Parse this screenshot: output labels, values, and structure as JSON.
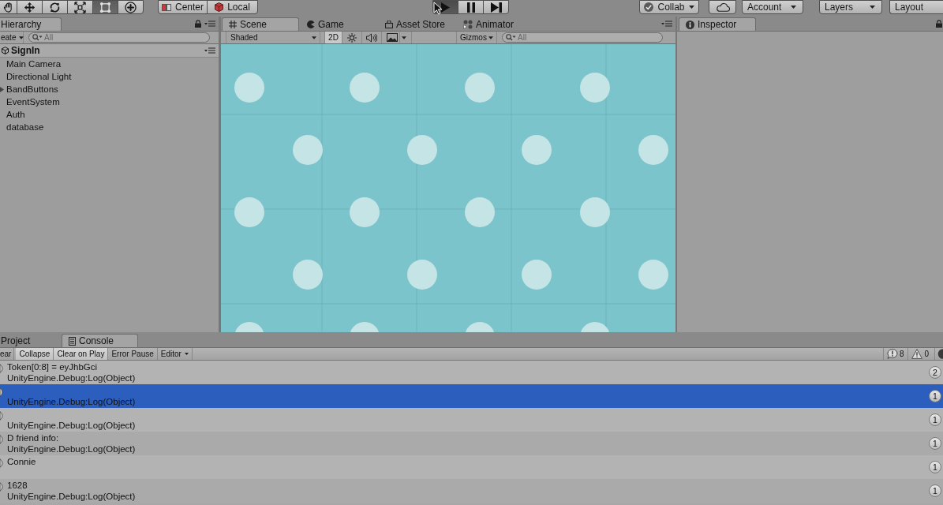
{
  "toolbar": {
    "tools": [
      {
        "kind": "hand",
        "selected": false
      },
      {
        "kind": "move",
        "selected": false
      },
      {
        "kind": "rotate",
        "selected": false
      },
      {
        "kind": "scale",
        "selected": false
      },
      {
        "kind": "rect",
        "selected": true
      },
      {
        "kind": "transform",
        "selected": false
      }
    ],
    "pivot": [
      {
        "kind": "pivot",
        "label": "Center"
      },
      {
        "kind": "space",
        "label": "Local"
      }
    ],
    "playback": [
      {
        "kind": "play",
        "selected": true
      },
      {
        "kind": "pause",
        "selected": false
      },
      {
        "kind": "step",
        "selected": false
      }
    ],
    "services": [
      {
        "kind": "collab",
        "label": "Collab"
      },
      {
        "kind": "cloud"
      },
      {
        "kind": "dropdown",
        "label": "Account"
      },
      {
        "kind": "dropdown",
        "label": "Layers"
      },
      {
        "kind": "plain",
        "label": "Layout"
      }
    ]
  },
  "hierarchy": {
    "tab": {
      "label": "Hierarchy",
      "selected": true
    },
    "create": {
      "label": "eate"
    },
    "search": {
      "placeholder": "All"
    },
    "scene": {
      "name": "SignIn"
    },
    "items": [
      {
        "name": "Main Camera",
        "kind": "object"
      },
      {
        "name": "Directional Light",
        "kind": "object"
      },
      {
        "name": "BandButtons",
        "kind": "parent",
        "expanded": false
      },
      {
        "name": "EventSystem",
        "kind": "object"
      },
      {
        "name": "Auth",
        "kind": "object"
      },
      {
        "name": "database",
        "kind": "object"
      }
    ]
  },
  "scene_panel": {
    "tabs": [
      {
        "kind": "scene",
        "label": "Scene",
        "selected": true
      },
      {
        "kind": "game",
        "label": "Game",
        "selected": false
      },
      {
        "kind": "store",
        "label": "Asset Store",
        "selected": false
      },
      {
        "kind": "animator",
        "label": "Animator",
        "selected": false
      }
    ],
    "toolbar": {
      "shading": {
        "label": "Shaded"
      },
      "toggles": [
        {
          "kind": "mode",
          "label": "2D",
          "on": true
        },
        {
          "kind": "lighting",
          "on": false
        },
        {
          "kind": "audio",
          "on": false
        },
        {
          "kind": "effects",
          "on": false
        }
      ],
      "gizmos": {
        "label": "Gizmos"
      },
      "search": {
        "placeholder": "All"
      }
    }
  },
  "inspector": {
    "tab": {
      "label": "Inspector",
      "selected": true
    }
  },
  "console_panel": {
    "tabs": [
      {
        "kind": "project",
        "label": "Project",
        "selected": false
      },
      {
        "kind": "console",
        "label": "Console",
        "selected": true
      }
    ],
    "toolbar": [
      {
        "kind": "button",
        "label": "ear"
      },
      {
        "kind": "toggle",
        "label": "Collapse",
        "on": true
      },
      {
        "kind": "toggle",
        "label": "Clear on Play",
        "on": true
      },
      {
        "kind": "toggle",
        "label": "Error Pause",
        "on": false
      },
      {
        "kind": "dropdown",
        "label": "Editor"
      }
    ],
    "counters": [
      {
        "kind": "info",
        "count": "8"
      },
      {
        "kind": "warning",
        "count": "0"
      },
      {
        "kind": "error"
      }
    ],
    "entries": [
      {
        "message": "Token[0:8] = eyJhbGci",
        "trace": "UnityEngine.Debug:Log(Object)",
        "count": "2",
        "selected": false
      },
      {
        "trace": "UnityEngine.Debug:Log(Object)",
        "count": "1",
        "selected": true
      },
      {
        "trace": "UnityEngine.Debug:Log(Object)",
        "count": "1",
        "selected": false
      },
      {
        "message": "D friend info:",
        "trace": "UnityEngine.Debug:Log(Object)",
        "count": "1",
        "selected": false
      },
      {
        "message": "Connie",
        "count": "1",
        "selected": false
      },
      {
        "message": "1628",
        "trace": "UnityEngine.Debug:Log(Object)",
        "count": "1",
        "selected": false
      }
    ]
  }
}
